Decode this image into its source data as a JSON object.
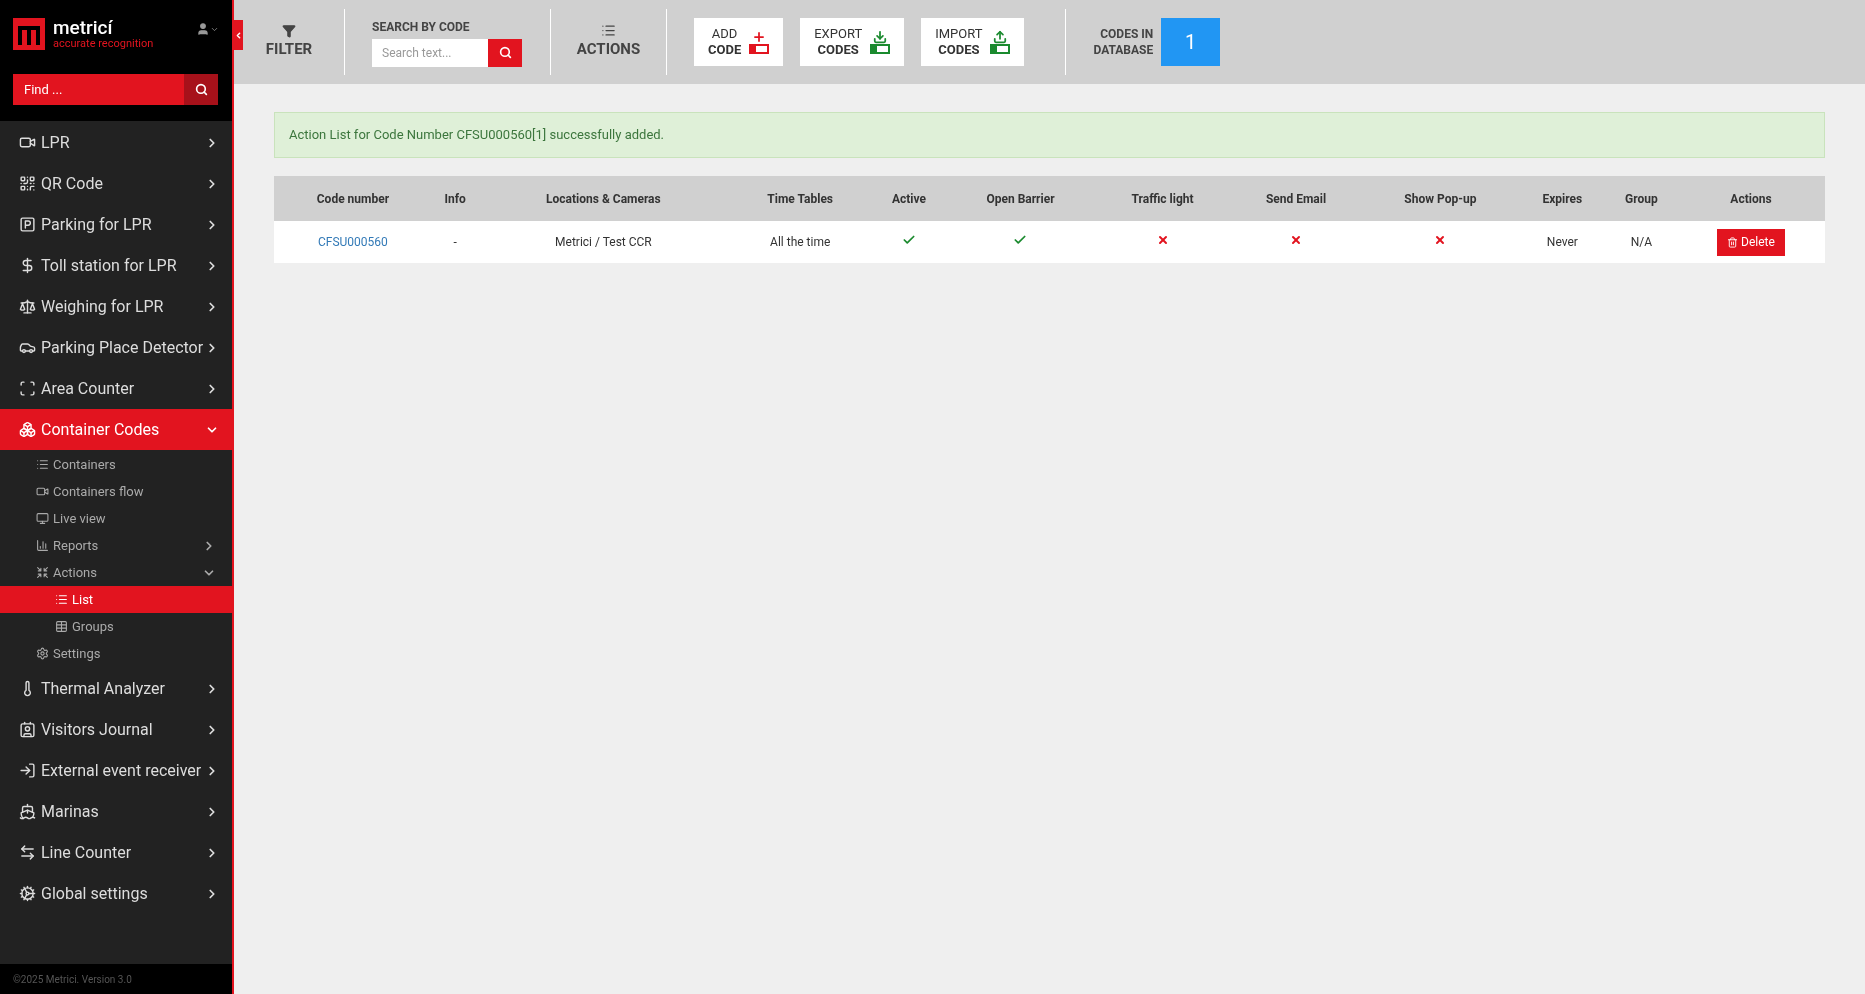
{
  "brand": {
    "name": "metricí",
    "tagline": "accurate recognition"
  },
  "sidebar": {
    "search": {
      "placeholder": "Find ..."
    },
    "items": [
      {
        "label": "LPR",
        "expanded": false,
        "selected": false
      },
      {
        "label": "QR Code",
        "expanded": false,
        "selected": false
      },
      {
        "label": "Parking for LPR",
        "expanded": false,
        "selected": false
      },
      {
        "label": "Toll station for LPR",
        "expanded": false,
        "selected": false
      },
      {
        "label": "Weighing for LPR",
        "expanded": false,
        "selected": false
      },
      {
        "label": "Parking Place Detector",
        "expanded": false,
        "selected": false
      },
      {
        "label": "Area Counter",
        "expanded": false,
        "selected": false
      },
      {
        "label": "Container Codes",
        "expanded": true,
        "selected": true,
        "children": [
          {
            "label": "Containers",
            "selected": false
          },
          {
            "label": "Containers flow",
            "selected": false
          },
          {
            "label": "Live view",
            "selected": false
          },
          {
            "label": "Reports",
            "selected": false,
            "expanded": false
          },
          {
            "label": "Actions",
            "selected": false,
            "expanded": true,
            "children": [
              {
                "label": "List",
                "selected": true
              },
              {
                "label": "Groups",
                "selected": false
              }
            ]
          },
          {
            "label": "Settings",
            "selected": false
          }
        ]
      },
      {
        "label": "Thermal Analyzer",
        "expanded": false,
        "selected": false
      },
      {
        "label": "Visitors Journal",
        "expanded": false,
        "selected": false
      },
      {
        "label": "External event receiver",
        "expanded": false,
        "selected": false
      },
      {
        "label": "Marinas",
        "expanded": false,
        "selected": false
      },
      {
        "label": "Line Counter",
        "expanded": false,
        "selected": false
      },
      {
        "label": "Global settings",
        "expanded": false,
        "selected": false
      }
    ],
    "footer": "©2025 Metrici. Version 3.0"
  },
  "toolbar": {
    "filter": "FILTER",
    "search_label": "SEARCH BY CODE",
    "search": {
      "placeholder": "Search text..."
    },
    "actions": "ACTIONS",
    "buttons": [
      {
        "kind": "add",
        "line1": "ADD",
        "line2": "CODE"
      },
      {
        "kind": "export",
        "line1": "EXPORT",
        "line2": "CODES"
      },
      {
        "kind": "import",
        "line1": "IMPORT",
        "line2": "CODES"
      }
    ],
    "count_label_1": "CODES IN",
    "count_label_2": "DATABASE",
    "count": "1"
  },
  "alert": "Action List for Code Number CFSU000560[1] successfully added.",
  "table": {
    "columns": [
      "Code number",
      "Info",
      "Locations & Cameras",
      "Time Tables",
      "Active",
      "Open Barrier",
      "Traffic light",
      "Send Email",
      "Show Pop-up",
      "Expires",
      "Group",
      "Actions"
    ],
    "rows": [
      {
        "code": "CFSU000560",
        "info": "-",
        "location": "Metrici / Test CCR",
        "time_table": "All the time",
        "active": true,
        "open_barrier": true,
        "traffic_light": false,
        "send_email": false,
        "show_popup": false,
        "expires": "Never",
        "group": "N/A",
        "action": "Delete"
      }
    ]
  }
}
